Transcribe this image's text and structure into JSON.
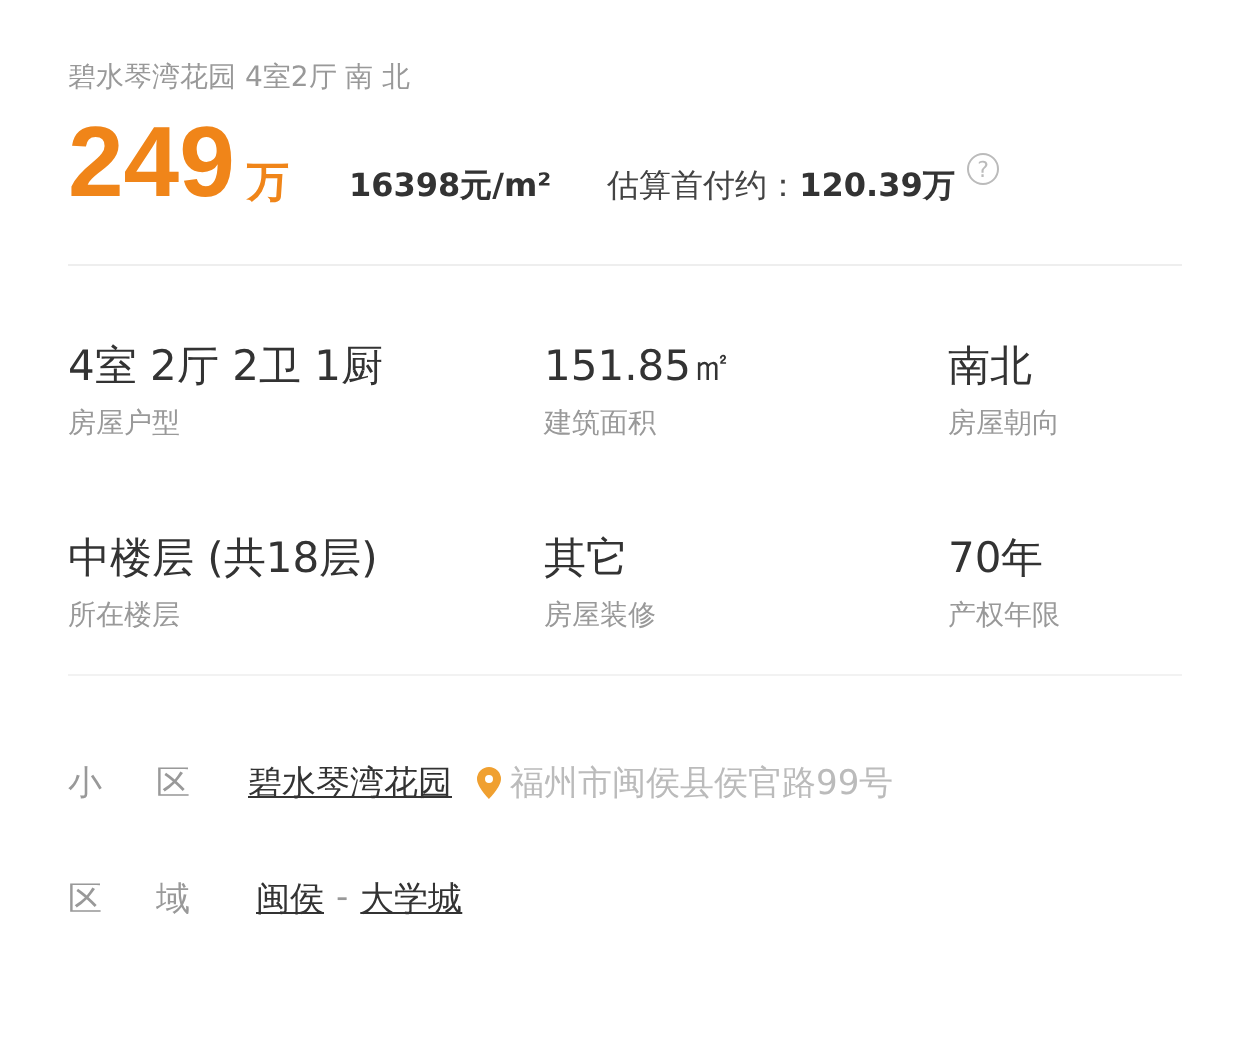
{
  "title": "碧水琴湾花园 4室2厅 南 北",
  "price": {
    "amount": "249",
    "unit": "万",
    "unit_price": "16398元/m²",
    "down_payment_label": "估算首付约：",
    "down_payment": "120.39万",
    "help_icon": "?"
  },
  "specs": [
    {
      "value": "4室 2厅 2卫 1厨",
      "label": "房屋户型"
    },
    {
      "value": "151.85㎡",
      "label": "建筑面积"
    },
    {
      "value": "南北",
      "label": "房屋朝向"
    },
    {
      "value": "中楼层 (共18层)",
      "label": "所在楼层"
    },
    {
      "value": "其它",
      "label": "房屋装修"
    },
    {
      "value": "70年",
      "label": "产权年限"
    }
  ],
  "community": {
    "label": "小区",
    "name": "碧水琴湾花园",
    "address": "福州市闽侯县侯官路99号"
  },
  "area": {
    "label": "区域",
    "district": "闽侯",
    "separator": "-",
    "subdistrict": "大学城"
  }
}
